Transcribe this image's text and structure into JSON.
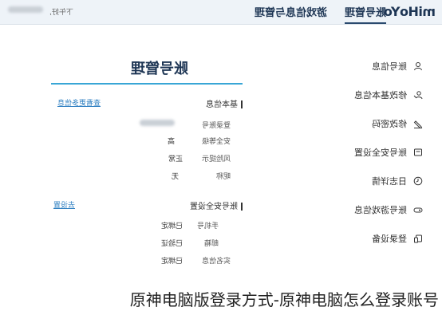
{
  "header": {
    "logo": "miHoYo",
    "nav": [
      "账号管理",
      "游戏信息与管理"
    ],
    "user": "下午好,"
  },
  "sidebar": {
    "items": [
      {
        "label": "账号信息",
        "icon": "user-icon"
      },
      {
        "label": "修改基本信息",
        "icon": "person-edit-icon"
      },
      {
        "label": "修改密码",
        "icon": "pencil-icon"
      },
      {
        "label": "账号安全设置",
        "icon": "shield-icon"
      },
      {
        "label": "日志详情",
        "icon": "clock-icon"
      },
      {
        "label": "账号游戏信息",
        "icon": "gamepad-icon"
      },
      {
        "label": "登录设备",
        "icon": "device-icon"
      }
    ]
  },
  "main": {
    "title": "账号管理",
    "basic": {
      "heading": "基本信息",
      "link": "查看更多信息",
      "rows": [
        {
          "label": "登录账号",
          "value": ""
        },
        {
          "label": "安全等级",
          "value": "高"
        },
        {
          "label": "风险提示",
          "value": "正常"
        },
        {
          "label": "昵称",
          "value": "无"
        }
      ]
    },
    "security": {
      "heading": "账号安全设置",
      "link": "去设置",
      "rows": [
        {
          "label": "手机号",
          "value": "已绑定"
        },
        {
          "label": "邮箱",
          "value": "已验证"
        },
        {
          "label": "实名信息",
          "value": "已绑定"
        }
      ]
    }
  },
  "caption": "原神电脑版登录方式-原神电脑怎么登录账号"
}
